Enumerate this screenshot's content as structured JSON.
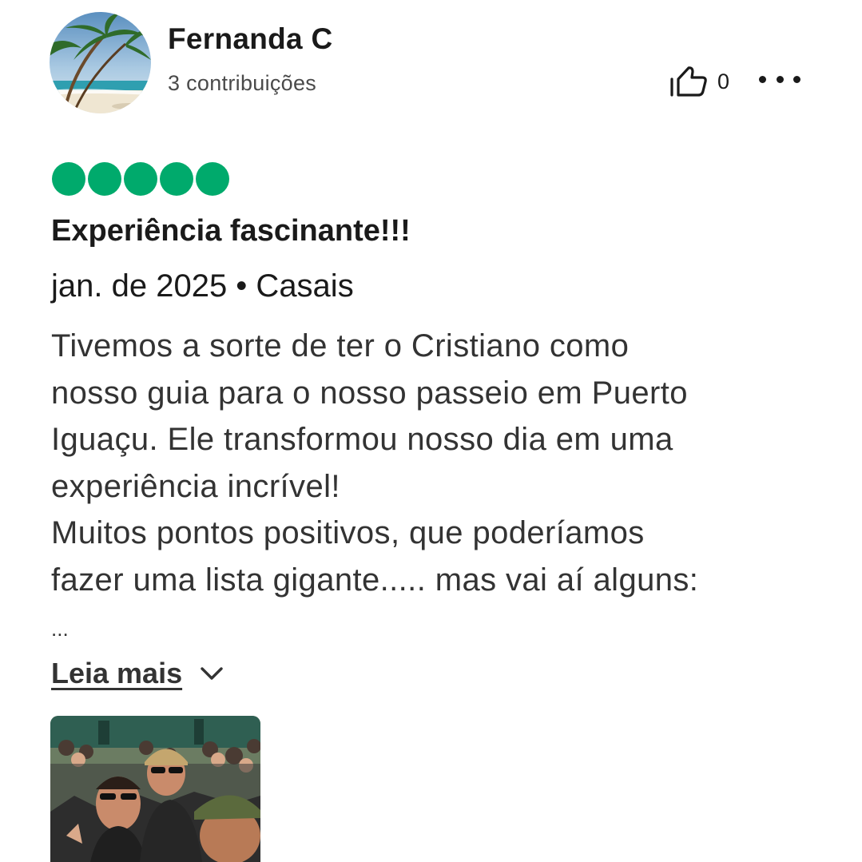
{
  "reviewer": {
    "name": "Fernanda C",
    "contributions": "3 contribuições",
    "avatar_icon": "beach-palm-avatar"
  },
  "actions": {
    "like_count": "0",
    "like_icon": "thumbs-up-icon",
    "more_icon": "more-options-icon"
  },
  "review": {
    "rating": 5,
    "rating_max": 5,
    "rating_color": "#00aa6c",
    "title": "Experiência fascinante!!!",
    "meta": "jan. de 2025 • Casais",
    "body_lines": [
      "Tivemos a sorte de ter o Cristiano como",
      "nosso guia para o nosso passeio em Puerto",
      "Iguaçu. Ele transformou nosso dia em uma",
      "experiência incrível!",
      "Muitos pontos positivos, que poderíamos",
      "fazer uma lista gigante..... mas vai aí alguns:"
    ],
    "truncation": "...",
    "read_more": "Leia mais",
    "read_more_icon": "chevron-down-icon"
  },
  "photos": [
    {
      "icon": "review-photo-thumbnail"
    }
  ]
}
